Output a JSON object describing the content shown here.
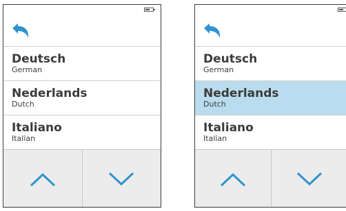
{
  "colors": {
    "accent": "#2e93cf",
    "selected_bg": "#b9dcee",
    "text": "#3b3b3b",
    "nav_bg": "#ececec"
  },
  "battery": {
    "level": 0.6
  },
  "icons": {
    "back": "back-arrow-icon",
    "up": "chevron-up-icon",
    "down": "chevron-down-icon"
  },
  "screens": [
    {
      "selected": null,
      "languages": [
        {
          "name": "Deutsch",
          "sub": "German"
        },
        {
          "name": "Nederlands",
          "sub": "Dutch"
        },
        {
          "name": "Italiano",
          "sub": "Italian"
        }
      ]
    },
    {
      "selected": 1,
      "languages": [
        {
          "name": "Deutsch",
          "sub": "German"
        },
        {
          "name": "Nederlands",
          "sub": "Dutch"
        },
        {
          "name": "Italiano",
          "sub": "Italian"
        }
      ]
    }
  ]
}
